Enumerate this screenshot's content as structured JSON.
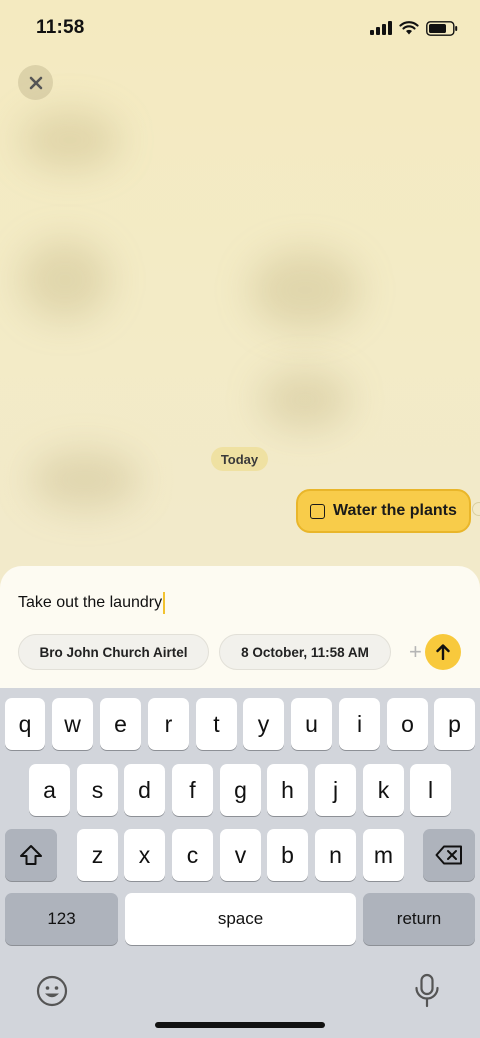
{
  "status_bar": {
    "time": "11:58"
  },
  "chat": {
    "date_chip": "Today",
    "task_label": "Water the plants"
  },
  "composer": {
    "input_value": "Take out the laundry",
    "chip_contact": "Bro John Church Airtel",
    "chip_datetime": "8 October, 11:58 AM",
    "plus_glyph": "+"
  },
  "keyboard": {
    "row1": [
      "q",
      "w",
      "e",
      "r",
      "t",
      "y",
      "u",
      "i",
      "o",
      "p"
    ],
    "row2": [
      "a",
      "s",
      "d",
      "f",
      "g",
      "h",
      "j",
      "k",
      "l"
    ],
    "row3": [
      "z",
      "x",
      "c",
      "v",
      "b",
      "n",
      "m"
    ],
    "numbers_label": "123",
    "space_label": "space",
    "return_label": "return"
  },
  "colors": {
    "accent": "#f8c93c",
    "background": "#f4eac0"
  }
}
